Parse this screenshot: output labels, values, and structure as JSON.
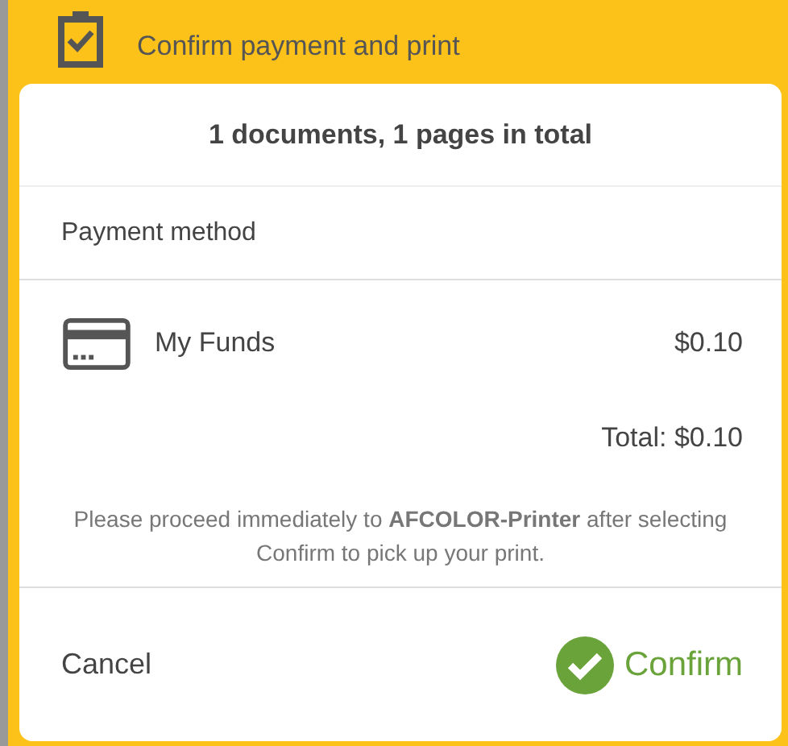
{
  "header": {
    "title": "Confirm payment and print"
  },
  "summary": "1 documents, 1 pages in total",
  "payment_section": {
    "label": "Payment method",
    "method": {
      "name": "My Funds",
      "amount": "$0.10"
    }
  },
  "total": "Total: $0.10",
  "note": "Please proceed immediately to **AFCOLOR-Printer** after selecting Confirm to pick up your print.",
  "buttons": [
    {
      "label": "Cancel",
      "kind": "cancel"
    },
    {
      "label": "Confirm",
      "kind": "confirm"
    }
  ]
}
